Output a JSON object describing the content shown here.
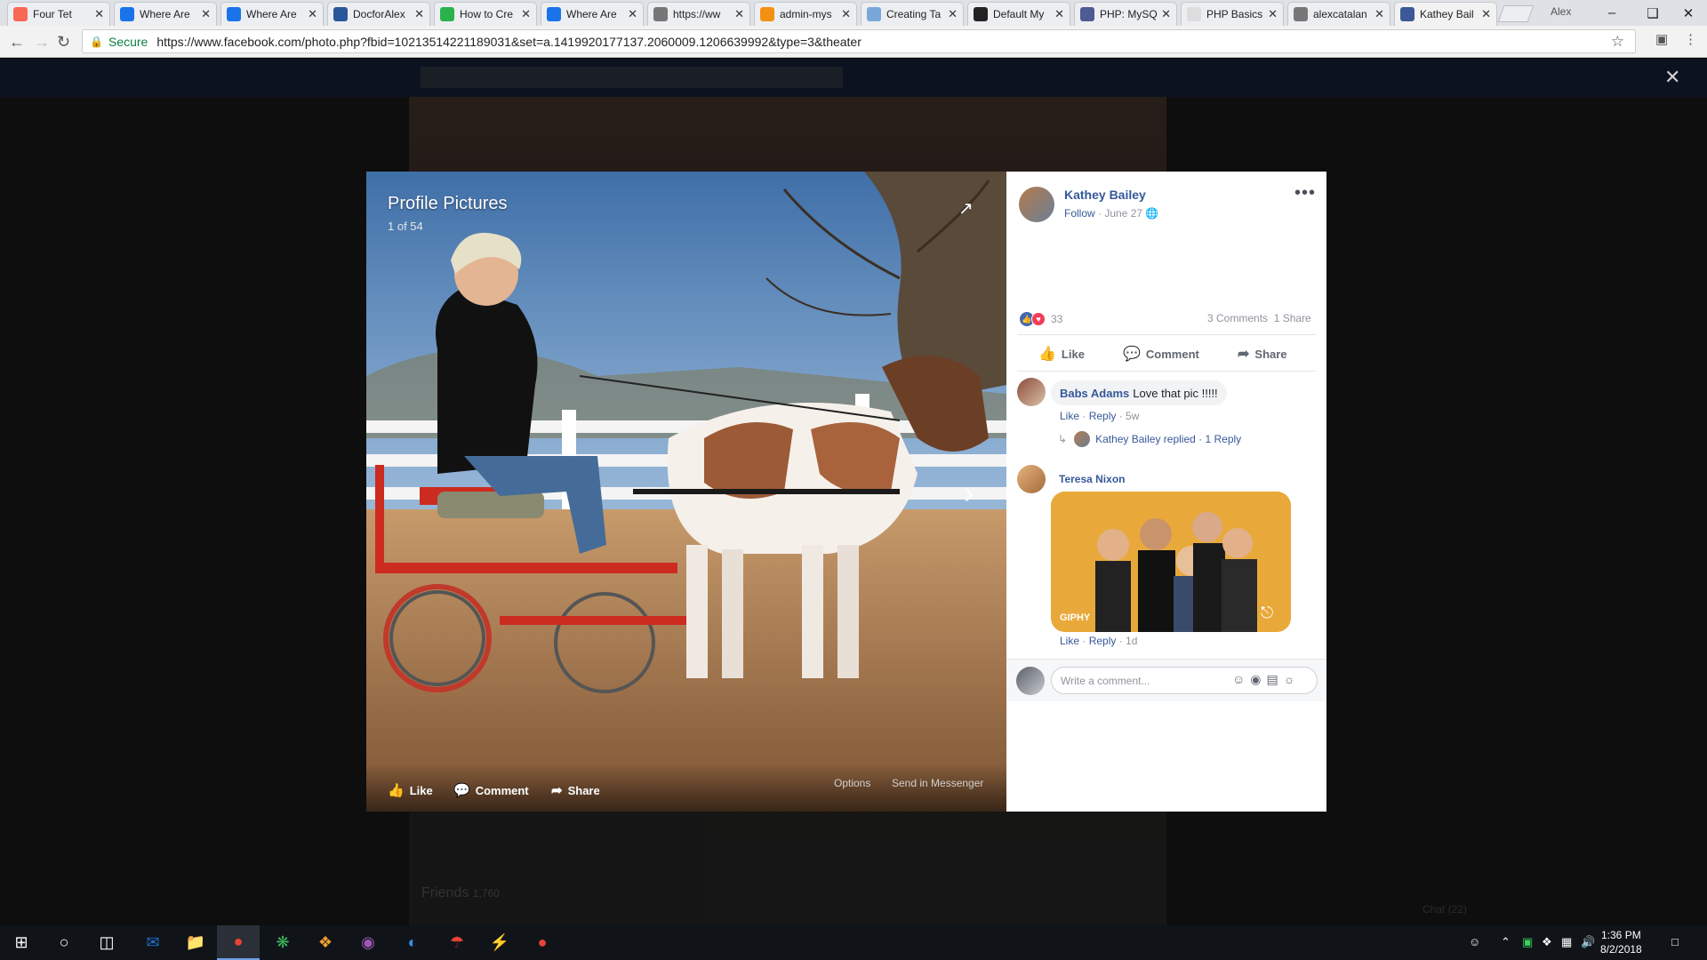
{
  "browser": {
    "tabs": [
      {
        "title": "Four Tet",
        "icon": "patreon-icon",
        "color": "#f96854",
        "extra": "audio-icon"
      },
      {
        "title": "Where Are",
        "icon": "question-icon",
        "color": "#1a73e8"
      },
      {
        "title": "Where Are",
        "icon": "question-icon",
        "color": "#1a73e8"
      },
      {
        "title": "DocforAlex",
        "icon": "word-icon",
        "color": "#2b579a"
      },
      {
        "title": "How to Cre",
        "icon": "feedly-icon",
        "color": "#2bb24c"
      },
      {
        "title": "Where Are",
        "icon": "question-icon",
        "color": "#1a73e8"
      },
      {
        "title": "https://ww",
        "icon": "page-icon",
        "color": "#777777"
      },
      {
        "title": "admin-mys",
        "icon": "phpmyadmin-icon",
        "color": "#f29111"
      },
      {
        "title": "Creating Ta",
        "icon": "cloud-icon",
        "color": "#7aa7d9"
      },
      {
        "title": "Default My",
        "icon": "mt-icon",
        "color": "#222222"
      },
      {
        "title": "PHP: MySQ",
        "icon": "php-icon",
        "color": "#4f5b93"
      },
      {
        "title": "PHP Basics",
        "icon": "blank-icon",
        "color": "#dddddd"
      },
      {
        "title": "alexcatalan",
        "icon": "page-icon",
        "color": "#777777"
      },
      {
        "title": "Kathey Bail",
        "icon": "facebook-icon",
        "color": "#3b5998",
        "active": true
      }
    ],
    "profile_name": "Alex",
    "secure_label": "Secure",
    "url": "https://www.facebook.com/photo.php?fbid=10213514221189031&set=a.1419920177137.2060009.1206639992&type=3&theater"
  },
  "photo": {
    "album_title": "Profile Pictures",
    "counter": "1 of 54",
    "actions": {
      "like": "Like",
      "comment": "Comment",
      "share": "Share"
    },
    "options": "Options",
    "send": "Send in Messenger"
  },
  "post": {
    "author": "Kathey Bailey",
    "follow": "Follow",
    "date": "June 27",
    "reactions_count": "33",
    "comments_count": "3 Comments",
    "shares_count": "1 Share",
    "actions": {
      "like": "Like",
      "comment": "Comment",
      "share": "Share"
    }
  },
  "comments": [
    {
      "name": "Babs Adams",
      "text": "Love that pic !!!!!",
      "like": "Like",
      "reply": "Reply",
      "time": "5w",
      "replied_by": "Kathey Bailey replied",
      "reply_count": "1 Reply"
    },
    {
      "name": "Teresa Nixon",
      "gif_label": "GIPHY",
      "like": "Like",
      "reply": "Reply",
      "time": "1d"
    }
  ],
  "composer": {
    "placeholder": "Write a comment..."
  },
  "background_page": {
    "friends_label": "Friends",
    "friends_count": "1,760",
    "chat_label": "Chat (22)"
  },
  "taskbar": {
    "time": "1:36 PM",
    "date": "8/2/2018"
  },
  "colors": {
    "fb_blue": "#365899",
    "accent": "#4267b2"
  }
}
